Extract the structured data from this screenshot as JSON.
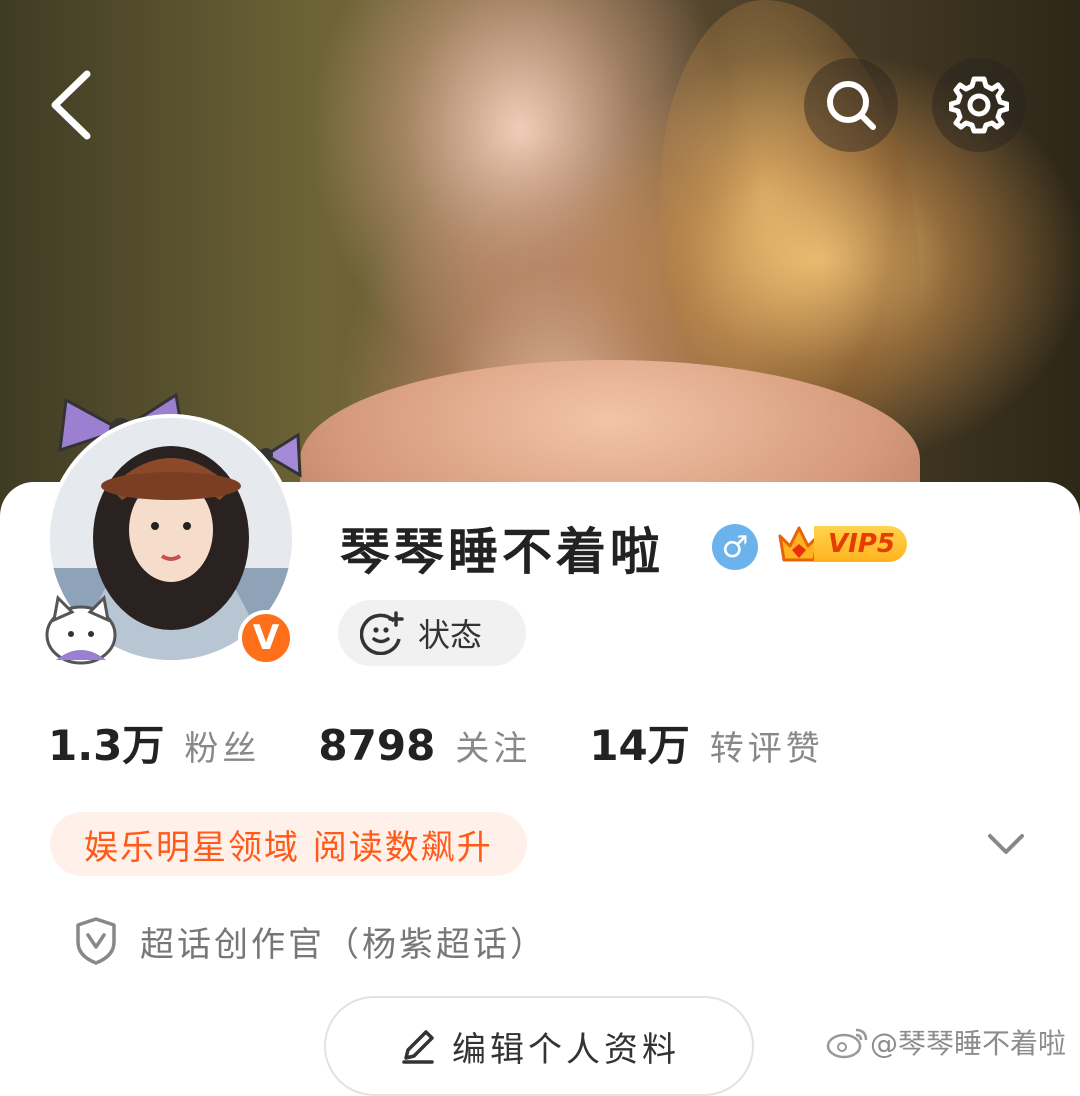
{
  "header": {
    "back_icon": "chevron-left-icon",
    "search_icon": "search-icon",
    "settings_icon": "gear-icon"
  },
  "profile": {
    "name": "琴琴睡不着啦",
    "gender_symbol": "♂",
    "vip_label": "VIP5",
    "verified_badge": "V",
    "status_label": "状态"
  },
  "stats": [
    {
      "value": "1.3万",
      "label": "粉丝"
    },
    {
      "value": "8798",
      "label": "关注"
    },
    {
      "value": "14万",
      "label": "转评赞"
    }
  ],
  "domain_tag": "娱乐明星领域 阅读数飙升",
  "role_text": "超话创作官（杨紫超话）",
  "edit_button": "编辑个人资料",
  "watermark": "@琴琴睡不着啦",
  "colors": {
    "accent": "#ff5a1a",
    "verified": "#ff6f1a",
    "gender": "#6cb3ee",
    "vip_gold": "#ffc233"
  }
}
